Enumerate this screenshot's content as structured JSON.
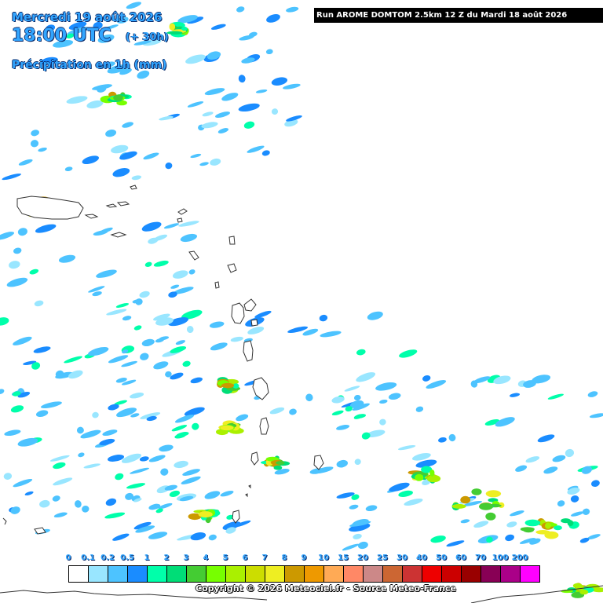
{
  "header": {
    "date": "Mercredi 19 août 2026",
    "time": "18:00 UTC",
    "lead": "(+ 30h)",
    "parameter": "Précipitation en 1h (mm)"
  },
  "run_banner": "Run AROME DOMTOM 2.5km 12 Z du Mardi 18 août 2026",
  "legend": {
    "unit": "mm",
    "labels": [
      "0",
      "0.1",
      "0.2",
      "0.5",
      "1",
      "2",
      "3",
      "4",
      "5",
      "6",
      "7",
      "8",
      "9",
      "10",
      "15",
      "20",
      "25",
      "30",
      "40",
      "50",
      "60",
      "70",
      "100",
      "200"
    ],
    "colors": [
      "#ffffff",
      "#99e6ff",
      "#4dc3ff",
      "#1a8cff",
      "#00ffaa",
      "#00dd77",
      "#44cc33",
      "#77ff00",
      "#aaf000",
      "#ccdd00",
      "#eeee22",
      "#cc9900",
      "#ee9900",
      "#ffaa55",
      "#ff8866",
      "#cc8888",
      "#cc6633",
      "#cc3333",
      "#ee0000",
      "#cc0000",
      "#990000",
      "#880055",
      "#aa0088",
      "#ff00ff"
    ]
  },
  "copyright": "Copyright © 2026 Meteociel.fr - Source Meteo-France"
}
